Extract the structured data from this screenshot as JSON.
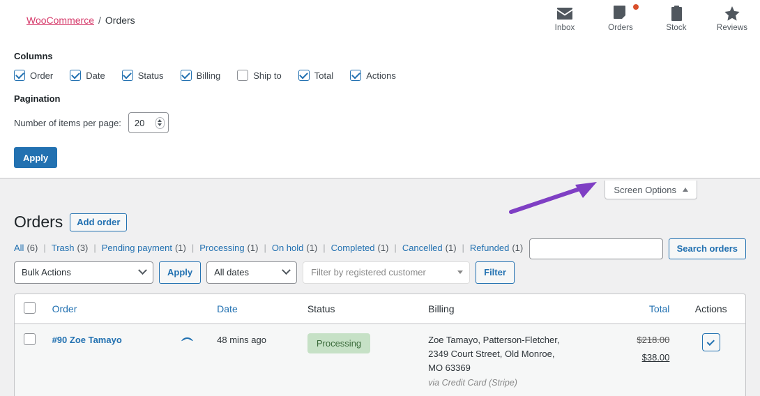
{
  "breadcrumb": {
    "root_label": "WooCommerce",
    "separator": "/",
    "current_label": "Orders"
  },
  "activity_panel": {
    "items": [
      {
        "label": "Inbox",
        "icon": "envelope-icon",
        "badge": false
      },
      {
        "label": "Orders",
        "icon": "document-icon",
        "badge": true
      },
      {
        "label": "Stock",
        "icon": "clipboard-icon",
        "badge": false
      },
      {
        "label": "Reviews",
        "icon": "star-icon",
        "badge": false
      }
    ]
  },
  "screen_options": {
    "tab_label": "Screen Options",
    "tab_caret": "caret-up",
    "columns_heading": "Columns",
    "columns": [
      {
        "label": "Order",
        "checked": true
      },
      {
        "label": "Date",
        "checked": true
      },
      {
        "label": "Status",
        "checked": true
      },
      {
        "label": "Billing",
        "checked": true
      },
      {
        "label": "Ship to",
        "checked": false
      },
      {
        "label": "Total",
        "checked": true
      },
      {
        "label": "Actions",
        "checked": true
      }
    ],
    "pagination_heading": "Pagination",
    "items_per_page_label": "Number of items per page:",
    "items_per_page_value": "20",
    "apply_label": "Apply"
  },
  "annotation": {
    "arrow_color": "#7f3fc4",
    "points_to": "Screen Options"
  },
  "page": {
    "title": "Orders",
    "add_order_label": "Add order"
  },
  "status_filters": [
    {
      "label": "All",
      "count": "(6)"
    },
    {
      "label": "Trash",
      "count": "(3)"
    },
    {
      "label": "Pending payment",
      "count": "(1)"
    },
    {
      "label": "Processing",
      "count": "(1)"
    },
    {
      "label": "On hold",
      "count": "(1)"
    },
    {
      "label": "Completed",
      "count": "(1)"
    },
    {
      "label": "Cancelled",
      "count": "(1)"
    },
    {
      "label": "Refunded",
      "count": "(1)"
    }
  ],
  "search": {
    "value": "",
    "placeholder": "",
    "button_label": "Search orders"
  },
  "tablenav": {
    "bulk_actions_value": "Bulk Actions",
    "apply_label": "Apply",
    "dates_value": "All dates",
    "customer_placeholder": "Filter by registered customer",
    "filter_label": "Filter"
  },
  "table": {
    "headers": {
      "order": "Order",
      "date": "Date",
      "status": "Status",
      "billing": "Billing",
      "total": "Total",
      "actions": "Actions"
    },
    "rows": [
      {
        "order_label": "#90 Zoe Tamayo",
        "date": "48 mins ago",
        "status": "Processing",
        "status_color": "#c6e1c6",
        "billing_line1": "Zoe Tamayo, Patterson-Fletcher,",
        "billing_line2": "2349 Court Street, Old Monroe,",
        "billing_line3": "MO 63369",
        "billing_via": "via Credit Card (Stripe)",
        "total_original": "$218.00",
        "total_current": "$38.00",
        "action_icon": "checkmark-icon"
      }
    ]
  }
}
